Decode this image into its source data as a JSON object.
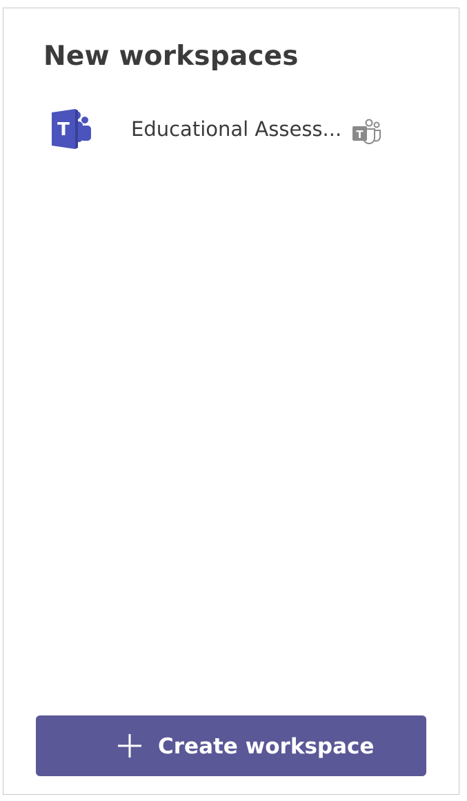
{
  "panel": {
    "title": "New workspaces"
  },
  "workspaces": [
    {
      "name": "Educational Assess...",
      "logo_icon": "microsoft-teams-logo",
      "badge_icon": "teams-badge-icon",
      "logo_letter": "T",
      "badge_letter": "T"
    }
  ],
  "create_button": {
    "label": "Create workspace",
    "icon": "plus-icon"
  },
  "colors": {
    "teams_purple": "#4b53bc",
    "teams_purple_dark": "#3a3f9b",
    "button_bg": "#5b5897",
    "title_text": "#3b3b3b",
    "badge_gray": "#8a8a8a",
    "border": "#c8c8c8"
  }
}
